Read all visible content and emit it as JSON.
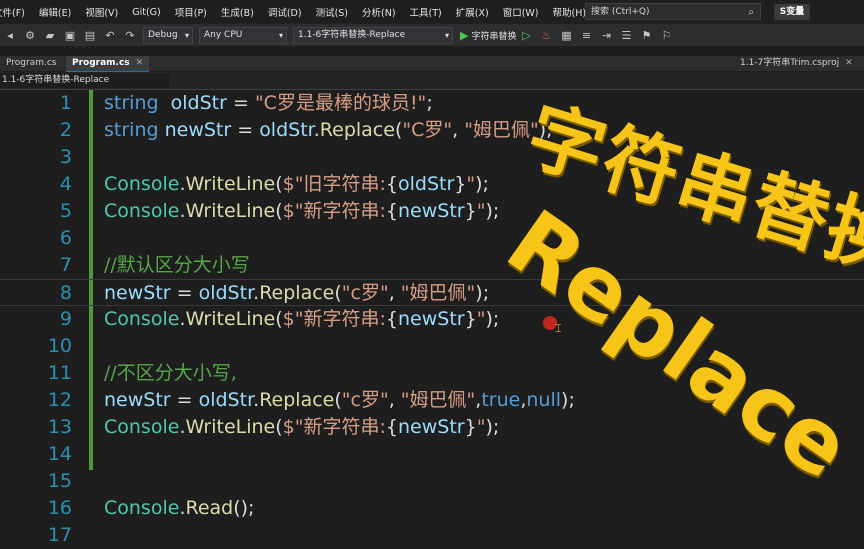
{
  "menu": [
    "文件(F)",
    "编辑(E)",
    "视图(V)",
    "Git(G)",
    "项目(P)",
    "生成(B)",
    "调试(D)",
    "测试(S)",
    "分析(N)",
    "工具(T)",
    "扩展(X)",
    "窗口(W)",
    "帮助(H)"
  ],
  "search": {
    "text": "搜索 (Ctrl+Q)"
  },
  "badge": "S变量",
  "toolbar": {
    "config": "Debug",
    "platform": "Any CPU",
    "startup": "1.1-6字符串替换-Replace",
    "run_label": "字符串替换"
  },
  "tabs": {
    "left": "Program.cs",
    "active": "Program.cs",
    "right": "1.1-7字符串Trim.csproj"
  },
  "nav": {
    "project": "1.1-6字符串替换-Replace"
  },
  "overlay": {
    "line1": "字符串替换",
    "line2": "Replace"
  },
  "colors": {
    "keyword": "#569cd6",
    "string": "#d69d85",
    "method": "#dcdcaa",
    "class": "#4ec9b0",
    "variable": "#9cdcfe",
    "comment": "#57a64a",
    "line_number": "#2b91af",
    "overlay": "#f7c418",
    "breakpoint": "#c0281c"
  },
  "lines": [
    {
      "n": "1",
      "tokens": [
        [
          "kw",
          "string"
        ],
        [
          "",
          "  "
        ],
        [
          "var",
          "oldStr"
        ],
        [
          "",
          " = "
        ],
        [
          "str",
          "\"C罗是最棒的球员!\""
        ],
        [
          "",
          ";"
        ]
      ]
    },
    {
      "n": "2",
      "tokens": [
        [
          "kw",
          "string"
        ],
        [
          "",
          " "
        ],
        [
          "var",
          "newStr"
        ],
        [
          "",
          " = "
        ],
        [
          "var",
          "oldStr"
        ],
        [
          "",
          "."
        ],
        [
          "fn",
          "Replace"
        ],
        [
          "",
          "("
        ],
        [
          "str",
          "\"C罗\""
        ],
        [
          "",
          ", "
        ],
        [
          "str",
          "\"姆巴佩\""
        ],
        [
          "",
          ");"
        ]
      ]
    },
    {
      "n": "3",
      "tokens": []
    },
    {
      "n": "4",
      "tokens": [
        [
          "cls",
          "Console"
        ],
        [
          "",
          "."
        ],
        [
          "fn",
          "WriteLine"
        ],
        [
          "",
          "("
        ],
        [
          "str",
          "$\"旧字符串:"
        ],
        [
          "",
          "{"
        ],
        [
          "var",
          "oldStr"
        ],
        [
          "",
          "}"
        ],
        [
          "str",
          "\""
        ],
        [
          "",
          ");"
        ]
      ]
    },
    {
      "n": "5",
      "tokens": [
        [
          "cls",
          "Console"
        ],
        [
          "",
          "."
        ],
        [
          "fn",
          "WriteLine"
        ],
        [
          "",
          "("
        ],
        [
          "str",
          "$\"新字符串:"
        ],
        [
          "",
          "{"
        ],
        [
          "var",
          "newStr"
        ],
        [
          "",
          "}"
        ],
        [
          "str",
          "\""
        ],
        [
          "",
          ");"
        ]
      ]
    },
    {
      "n": "6",
      "tokens": []
    },
    {
      "n": "7",
      "tokens": [
        [
          "cmt",
          "//默认区分大小写"
        ]
      ]
    },
    {
      "n": "8",
      "tokens": [
        [
          "var",
          "newStr"
        ],
        [
          "",
          " = "
        ],
        [
          "var",
          "oldStr"
        ],
        [
          "",
          "."
        ],
        [
          "fn",
          "Replace"
        ],
        [
          "",
          "("
        ],
        [
          "str",
          "\"c罗\""
        ],
        [
          "",
          ", "
        ],
        [
          "str",
          "\"姆巴佩\""
        ],
        [
          "",
          ");"
        ]
      ]
    },
    {
      "n": "9",
      "tokens": [
        [
          "cls",
          "Console"
        ],
        [
          "",
          "."
        ],
        [
          "fn",
          "WriteLine"
        ],
        [
          "",
          "("
        ],
        [
          "str",
          "$\"新字符串:"
        ],
        [
          "",
          "{"
        ],
        [
          "var",
          "newStr"
        ],
        [
          "",
          "}"
        ],
        [
          "str",
          "\""
        ],
        [
          "",
          ");"
        ]
      ]
    },
    {
      "n": "10",
      "tokens": []
    },
    {
      "n": "11",
      "tokens": [
        [
          "cmt",
          "//不区分大小写,"
        ]
      ]
    },
    {
      "n": "12",
      "tokens": [
        [
          "var",
          "newStr"
        ],
        [
          "",
          " = "
        ],
        [
          "var",
          "oldStr"
        ],
        [
          "",
          "."
        ],
        [
          "fn",
          "Replace"
        ],
        [
          "",
          "("
        ],
        [
          "str",
          "\"c罗\""
        ],
        [
          "",
          ", "
        ],
        [
          "str",
          "\"姆巴佩\""
        ],
        [
          "",
          ","
        ],
        [
          "kw",
          "true"
        ],
        [
          "",
          ","
        ],
        [
          "kw",
          "null"
        ],
        [
          "",
          ");"
        ]
      ]
    },
    {
      "n": "13",
      "tokens": [
        [
          "cls",
          "Console"
        ],
        [
          "",
          "."
        ],
        [
          "fn",
          "WriteLine"
        ],
        [
          "",
          "("
        ],
        [
          "str",
          "$\"新字符串:"
        ],
        [
          "",
          "{"
        ],
        [
          "var",
          "newStr"
        ],
        [
          "",
          "}"
        ],
        [
          "str",
          "\""
        ],
        [
          "",
          ");"
        ]
      ]
    },
    {
      "n": "14",
      "tokens": []
    },
    {
      "n": "15",
      "tokens": []
    },
    {
      "n": "16",
      "tokens": [
        [
          "cls",
          "Console"
        ],
        [
          "",
          "."
        ],
        [
          "fn",
          "Read"
        ],
        [
          "",
          "();"
        ]
      ]
    },
    {
      "n": "17",
      "tokens": []
    }
  ]
}
